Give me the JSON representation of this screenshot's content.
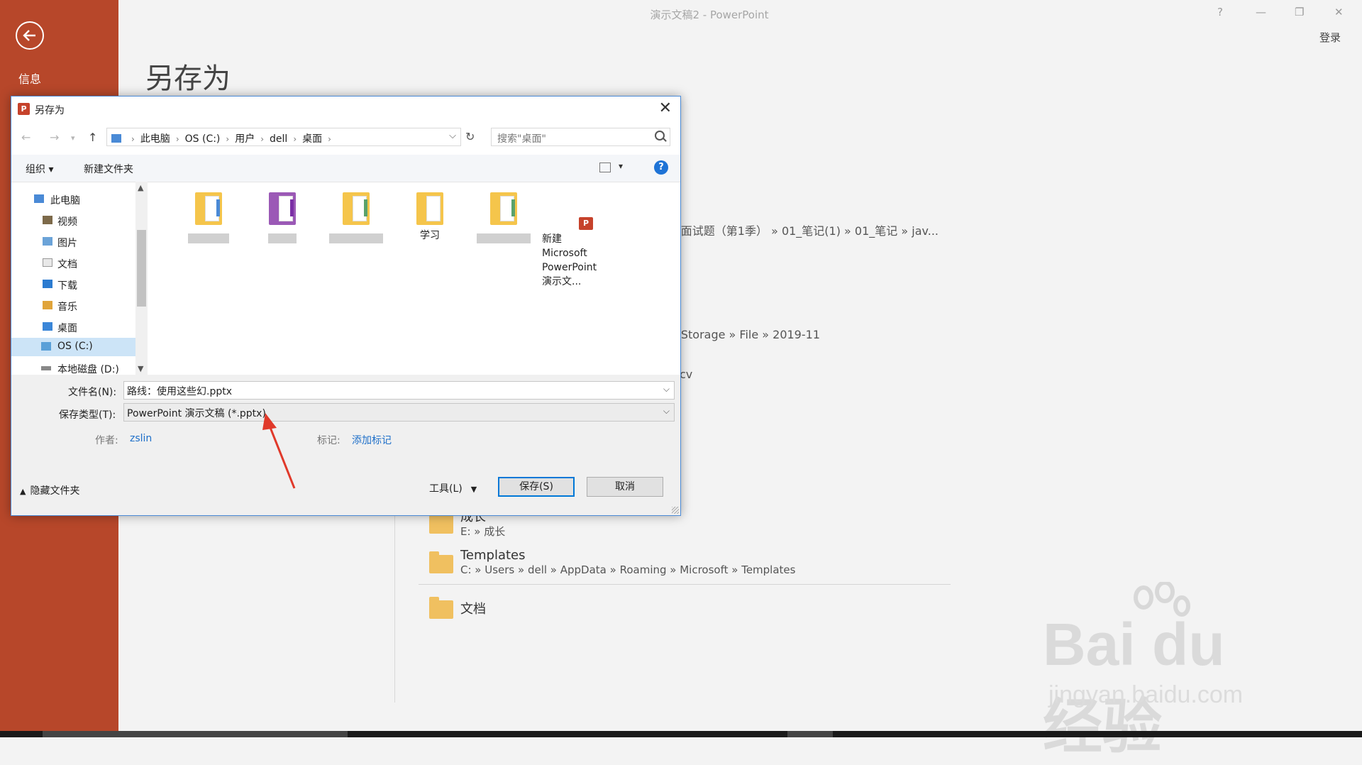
{
  "app": {
    "title": "演示文稿2 - PowerPoint",
    "login": "登录",
    "win_help": "?"
  },
  "backstage": {
    "info_label": "信息",
    "heading": "另存为"
  },
  "background_paths": [
    "a面试题（第1季） » 01_笔记(1) » 01_笔记 » jav...",
    "eStorage » File » 2019-11",
    "cv"
  ],
  "recent_folders": [
    {
      "name": "成长",
      "path": "E: » 成长"
    },
    {
      "name": "Templates",
      "path": "C: » Users » dell » AppData » Roaming » Microsoft » Templates"
    },
    {
      "name": "文档",
      "path": ""
    }
  ],
  "dialog": {
    "title": "另存为",
    "address": [
      "此电脑",
      "OS (C:)",
      "用户",
      "dell",
      "桌面"
    ],
    "search_placeholder": "搜索\"桌面\"",
    "toolbar": {
      "organize": "组织 ▾",
      "new_folder": "新建文件夹"
    },
    "tree": [
      {
        "label": "此电脑",
        "icon": "computer-icon"
      },
      {
        "label": "视频",
        "icon": "video-folder-icon"
      },
      {
        "label": "图片",
        "icon": "pictures-folder-icon"
      },
      {
        "label": "文档",
        "icon": "documents-folder-icon"
      },
      {
        "label": "下载",
        "icon": "download-folder-icon"
      },
      {
        "label": "音乐",
        "icon": "music-folder-icon"
      },
      {
        "label": "桌面",
        "icon": "desktop-folder-icon"
      },
      {
        "label": "OS (C:)",
        "icon": "drive-icon",
        "selected": true
      },
      {
        "label": "本地磁盘 (D:)",
        "icon": "drive-icon"
      }
    ],
    "files": [
      {
        "label": "",
        "type": "folder"
      },
      {
        "label": "",
        "type": "folder"
      },
      {
        "label": "",
        "type": "folder"
      },
      {
        "label": "学习",
        "type": "folder"
      },
      {
        "label": "",
        "type": "folder"
      },
      {
        "label": "新建 Microsoft PowerPoint 演示文...",
        "type": "pptx"
      }
    ],
    "filename_label": "文件名(N):",
    "filename_value": "路线：使用这些幻.pptx",
    "savetype_label": "保存类型(T):",
    "savetype_value": "PowerPoint 演示文稿 (*.pptx)",
    "author_label": "作者:",
    "author_value": "zslin",
    "tags_label": "标记:",
    "tags_value": "添加标记",
    "tools_label": "工具(L)",
    "save_label": "保存(S)",
    "cancel_label": "取消",
    "hide_folders_label": "隐藏文件夹"
  },
  "watermark": {
    "brand": "Bai du 经验",
    "url": "jingyan.baidu.com"
  }
}
